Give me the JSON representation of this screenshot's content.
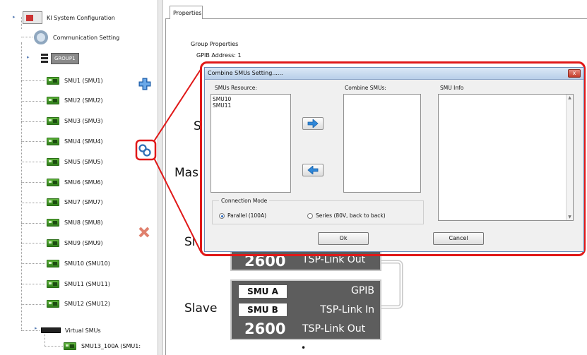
{
  "tree": {
    "root_label": "KI System Configuration",
    "comm_label": "Communication Setting",
    "group_label": "GROUP1",
    "smus": [
      "SMU1 (SMU1)",
      "SMU2 (SMU2)",
      "SMU3 (SMU3)",
      "SMU4 (SMU4)",
      "SMU5 (SMU5)",
      "SMU6 (SMU6)",
      "SMU7 (SMU7)",
      "SMU8 (SMU8)",
      "SMU9 (SMU9)",
      "SMU10 (SMU10)",
      "SMU11 (SMU11)",
      "SMU12 (SMU12)"
    ],
    "virtual_label": "Virtual SMUs",
    "virtual_child": "SMU13_100A (SMU1:"
  },
  "toolbar": {
    "add_icon": "plus-icon",
    "combine_icon": "link-icon",
    "remove_icon": "x-icon"
  },
  "properties": {
    "tab_label": "Properties",
    "group_properties": "Group Properties",
    "gpib_address": "GPIB Address:  1"
  },
  "diagram": {
    "s_partial": "S",
    "master_partial": "Mas",
    "slave_partial": "Sl",
    "slave_label": "Slave",
    "top_unit": {
      "model": "2600",
      "tsp_out": "TSP-Link Out"
    },
    "bottom_unit": {
      "smu_a": "SMU A",
      "smu_b": "SMU B",
      "gpib": "GPIB",
      "tsp_in": "TSP-Link In",
      "model": "2600",
      "tsp_out": "TSP-Link Out"
    },
    "dot": "•"
  },
  "dialog": {
    "title": "Combine SMUs Setting......",
    "close": "x",
    "resource_label": "SMUs Resource:",
    "resources": [
      "SMU10",
      "SMU11"
    ],
    "combine_label": "Combine SMUs:",
    "info_label": "SMU Info",
    "connection_mode_label": "Connection Mode",
    "parallel_label": "Parallel (100A)",
    "series_label": "Series (80V, back to back)",
    "ok_label": "Ok",
    "cancel_label": "Cancel"
  },
  "colors": {
    "callout": "#e01818",
    "accent_blue": "#2f87d8"
  }
}
